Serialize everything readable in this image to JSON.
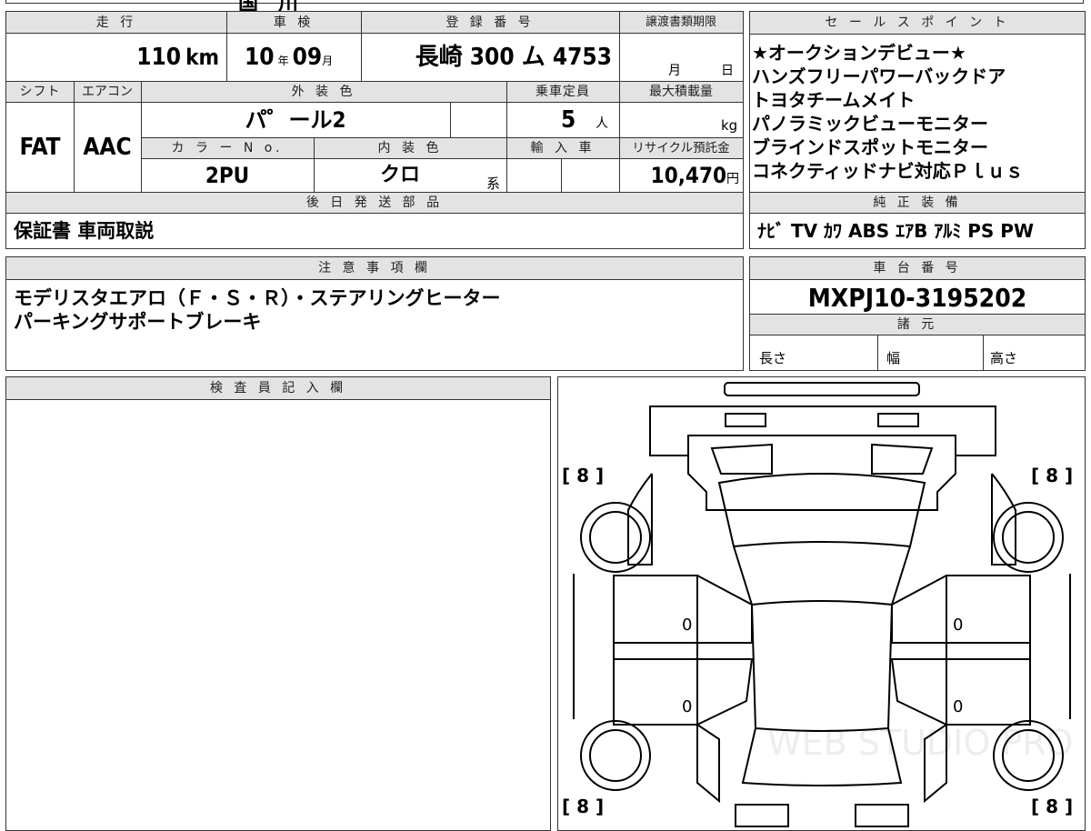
{
  "top_strip": {
    "fragments": [
      "",
      "国",
      "川"
    ]
  },
  "headers": {
    "mileage": "走 行",
    "inspection": "車 検",
    "registration": "登 録 番 号",
    "deadline": "譲渡書類期限",
    "shift": "シフト",
    "aircon": "エアコン",
    "exterior": "外 装 色",
    "capacity": "乗車定員",
    "maxload": "最大積載量",
    "color_no": "カ ラ ー N o.",
    "interior": "内 装 色",
    "import": "輸 入 車",
    "recycle": "リサイクル預託金",
    "parts": "後 日 発 送 部 品",
    "notes": "注 意 事 項 欄",
    "inspector": "検 査 員 記 入 欄",
    "sales": "セ ー ル ス ポ イ ン ト",
    "equipment": "純 正 装 備",
    "chassis": "車 台 番 号",
    "specs": "諸 元"
  },
  "values": {
    "mileage": "110",
    "mileage_unit": "km",
    "insp_year": "10",
    "insp_year_unit": "年",
    "insp_month": "09",
    "insp_month_unit": "月",
    "reg_place": "長崎",
    "reg_number": "300 ム 4753",
    "deadline_month": "月",
    "deadline_day": "日",
    "shift": "FAT",
    "aircon": "AAC",
    "exterior": "パ゜ール2",
    "capacity": "5",
    "capacity_unit": "人",
    "maxload_unit": "kg",
    "color_no": "2PU",
    "interior": "クロ",
    "interior_unit": "系",
    "recycle": "10,470",
    "recycle_unit": "円",
    "parts": "保証書 車両取説"
  },
  "sales_points": [
    "★オークションデビュー★",
    "ハンズフリーパワーバックドア",
    "トヨタチームメイト",
    "パノラミックビューモニター",
    "ブラインドスポットモニター",
    "コネクティッドナビ対応Ｐｌｕｓ"
  ],
  "equipment": "ﾅﾋﾞ TV ｶﾜ ABS ｴｱB ｱﾙﾐ PS PW",
  "chassis": "MXPJ10-3195202",
  "specs": {
    "length": "長さ",
    "width": "幅",
    "height": "高さ"
  },
  "notes": [
    "モデリスタエアロ（Ｆ・Ｓ・Ｒ）・ステアリングヒーター",
    "パーキングサポートブレーキ"
  ],
  "diagram": {
    "tire_fl": "[ 8 ]",
    "tire_fr": "[ 8 ]",
    "tire_rl": "[ 8 ]",
    "tire_rr": "[ 8 ]",
    "door_fl": "0",
    "door_fr": "0",
    "door_rl": "0",
    "door_rr": "0",
    "watermark": "WEB STUDIO PRO"
  }
}
